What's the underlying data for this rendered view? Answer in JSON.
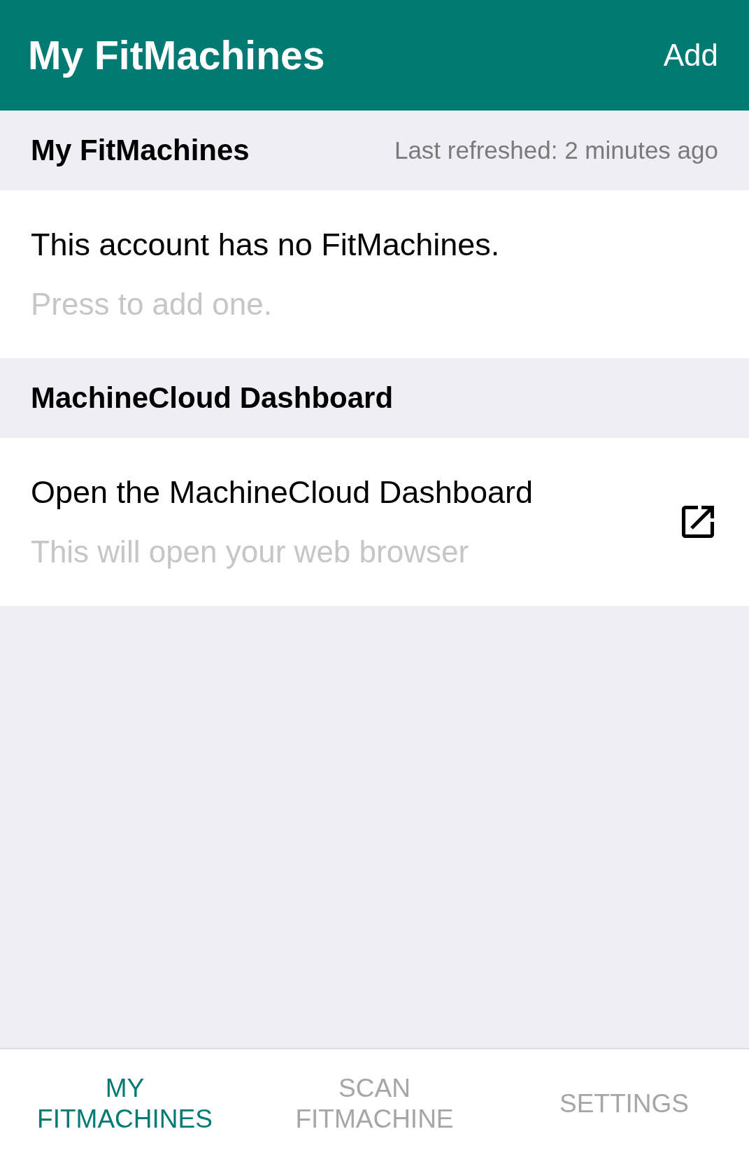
{
  "app_bar": {
    "title": "My FitMachines",
    "action": "Add"
  },
  "sections": [
    {
      "header": "My FitMachines",
      "meta": "Last refreshed: 2 minutes ago",
      "rows": [
        {
          "kind": "plain",
          "title": "This account has no FitMachines.",
          "subtitle": "Press to add one."
        }
      ]
    },
    {
      "header": "MachineCloud Dashboard",
      "rows": [
        {
          "kind": "external-link",
          "title": "Open the MachineCloud Dashboard",
          "subtitle": "This will open your web browser"
        }
      ]
    }
  ],
  "tabs": [
    {
      "label": "MY FITMACHINES",
      "selected": true
    },
    {
      "label": "SCAN FITMACHINE",
      "selected": false
    },
    {
      "label": "SETTINGS",
      "selected": false
    }
  ]
}
